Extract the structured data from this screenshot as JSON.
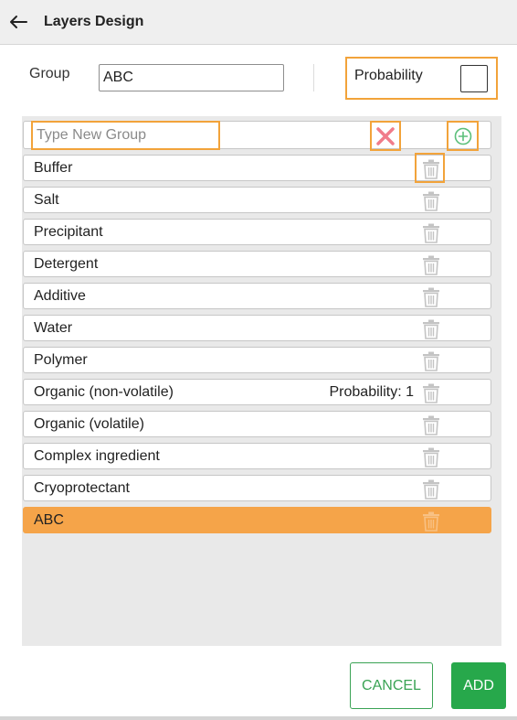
{
  "header": {
    "title": "Layers Design",
    "back_icon": "arrow-left-icon"
  },
  "form": {
    "group_label": "Group",
    "group_value": "ABC",
    "probability_label": "Probability",
    "probability_checked": false
  },
  "new_group": {
    "placeholder": "Type New Group",
    "value": "",
    "clear_icon": "x-icon",
    "add_icon": "plus-circle-icon"
  },
  "groups": [
    {
      "label": "Buffer",
      "probability": ""
    },
    {
      "label": "Salt",
      "probability": ""
    },
    {
      "label": "Precipitant",
      "probability": ""
    },
    {
      "label": "Detergent",
      "probability": ""
    },
    {
      "label": "Additive",
      "probability": ""
    },
    {
      "label": "Water",
      "probability": ""
    },
    {
      "label": "Polymer",
      "probability": ""
    },
    {
      "label": "Organic (non-volatile)",
      "probability": "Probability: 1"
    },
    {
      "label": "Organic (volatile)",
      "probability": ""
    },
    {
      "label": "Complex ingredient",
      "probability": ""
    },
    {
      "label": "Cryoprotectant",
      "probability": ""
    },
    {
      "label": "ABC",
      "probability": "",
      "selected": true
    }
  ],
  "actions": {
    "cancel_label": "CANCEL",
    "add_label": "ADD"
  },
  "colors": {
    "accent_orange": "#f5a449",
    "highlight_border": "#f2a33a",
    "green": "#27a84b",
    "delete_x": "#f07c8a",
    "trash_gray": "#c4c4c4"
  }
}
